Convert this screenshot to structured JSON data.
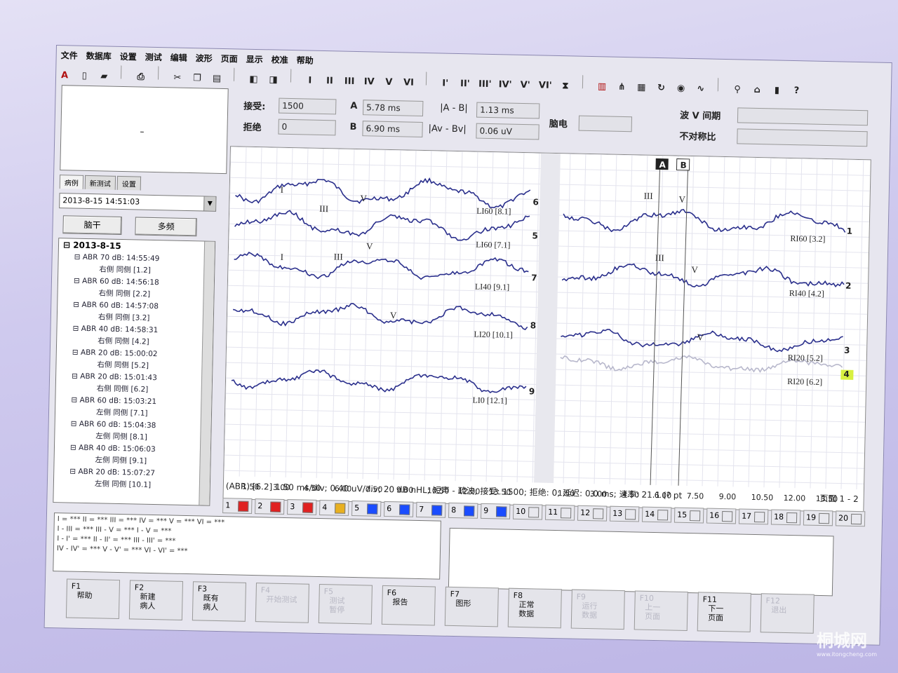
{
  "menu": [
    "文件",
    "数据库",
    "设置",
    "测试",
    "编辑",
    "波形",
    "页面",
    "显示",
    "校准",
    "帮助"
  ],
  "toolbar": {
    "roman": [
      "I",
      "II",
      "III",
      "IV",
      "V",
      "VI"
    ],
    "roman_prime": [
      "I'",
      "II'",
      "III'",
      "IV'",
      "V'",
      "VI'"
    ]
  },
  "info": {
    "accept_label": "接受:",
    "accept_value": "1500",
    "reject_label": "拒绝",
    "reject_value": "0",
    "a_label": "A",
    "a_value": "5.78 ms",
    "b_label": "B",
    "b_value": "6.90 ms",
    "ab_label": "|A - B|",
    "ab_value": "1.13 ms",
    "avbv_label": "|Av - Bv|",
    "avbv_value": "0.06 uV",
    "eeg_label": "脑电",
    "wave_v_label": "波 V 间期",
    "asym_label": "不对称比"
  },
  "left": {
    "tabs": [
      "病例",
      "新测试",
      "设置"
    ],
    "datetime": "2013-8-15 14:51:03",
    "btn_trunk": "脑干",
    "btn_multi": "多频",
    "tree_root": "2013-8-15",
    "tree": [
      {
        "node": "ABR 70 dB: 14:55:49",
        "child": "右侧 同侧 [1.2]"
      },
      {
        "node": "ABR 60 dB: 14:56:18",
        "child": "右侧 同侧 [2.2]"
      },
      {
        "node": "ABR 60 dB: 14:57:08",
        "child": "右侧 同侧 [3.2]"
      },
      {
        "node": "ABR 40 dB: 14:58:31",
        "child": "右侧 同侧 [4.2]"
      },
      {
        "node": "ABR 20 dB: 15:00:02",
        "child": "右侧 同侧 [5.2]"
      },
      {
        "node": "ABR 20 dB: 15:01:43",
        "child": "右侧 同侧 [6.2]"
      },
      {
        "node": "ABR 60 dB: 15:03:21",
        "child": "左侧 同侧 [7.1]"
      },
      {
        "node": "ABR 60 dB: 15:04:38",
        "child": "左侧 同侧 [8.1]"
      },
      {
        "node": "ABR 40 dB: 15:06:03",
        "child": "左侧 同侧 [9.1]"
      },
      {
        "node": "ABR 20 dB: 15:07:27",
        "child": "左侧 同侧 [10.1]"
      }
    ]
  },
  "plot": {
    "left_labels": [
      {
        "text": "LI60 [8.1]",
        "num": "6"
      },
      {
        "text": "LI60 [7.1]",
        "num": "5"
      },
      {
        "text": "LI40 [9.1]",
        "num": "7"
      },
      {
        "text": "LI20 [10.1]",
        "num": "8"
      },
      {
        "text": "LI0 [12.1]",
        "num": "9"
      }
    ],
    "right_labels": [
      {
        "text": "RI60 [3.2]",
        "num": "1"
      },
      {
        "text": "RI40 [4.2]",
        "num": "2"
      },
      {
        "text": "RI20 [5.2]",
        "num": "3"
      },
      {
        "text": "RI20 [6.2]",
        "num": "4"
      }
    ],
    "wave_marks": [
      "I",
      "III",
      "V",
      "I",
      "III",
      "V",
      "V",
      "III",
      "V",
      "III",
      "V",
      "V"
    ],
    "cursor_a": "A",
    "cursor_b": "B",
    "xticks": [
      "1.50",
      "3.00",
      "4.50",
      "6.00",
      "7.50",
      "9.00",
      "10.50",
      "12.00",
      "13.50"
    ],
    "trace_color": "#2a2f8c"
  },
  "status": {
    "text": "(ABR) [6.2]  1.50 ms/div;  0.40 uV/div;  20 dB nHL;  短声 - 疏波;  接受: 1500;  拒绝: 0;  延迟: 0.0 ms;  速率: 21.1 (? pt",
    "page": "页面 1 - 2"
  },
  "channels": [
    {
      "n": "1",
      "color": "#e02020"
    },
    {
      "n": "2",
      "color": "#e02020"
    },
    {
      "n": "3",
      "color": "#e02020"
    },
    {
      "n": "4",
      "color": "#e8b020"
    },
    {
      "n": "5",
      "color": "#1a4cff"
    },
    {
      "n": "6",
      "color": "#1a4cff"
    },
    {
      "n": "7",
      "color": "#1a4cff"
    },
    {
      "n": "8",
      "color": "#1a4cff"
    },
    {
      "n": "9",
      "color": "#1a4cff"
    },
    {
      "n": "10",
      "color": ""
    },
    {
      "n": "11",
      "color": ""
    },
    {
      "n": "12",
      "color": ""
    },
    {
      "n": "13",
      "color": ""
    },
    {
      "n": "14",
      "color": ""
    },
    {
      "n": "15",
      "color": ""
    },
    {
      "n": "16",
      "color": ""
    },
    {
      "n": "17",
      "color": ""
    },
    {
      "n": "18",
      "color": ""
    },
    {
      "n": "19",
      "color": ""
    },
    {
      "n": "20",
      "color": ""
    }
  ],
  "peaks": {
    "line1": "I = ***    II = ***    III = ***    IV = ***    V = ***    VI = ***",
    "line2": "I - III = ***    III - V = ***    I - V = ***",
    "line3": "I - I' = ***    II - II' = ***    III - III' = ***",
    "line4": "IV - IV' = ***    V - V' = ***    VI - VI' = ***"
  },
  "fkeys": [
    {
      "key": "F1",
      "label": "帮助",
      "enabled": true
    },
    {
      "key": "F2",
      "label": "新建\n病人",
      "enabled": true
    },
    {
      "key": "F3",
      "label": "既有\n病人",
      "enabled": true
    },
    {
      "key": "F4",
      "label": "开始测试",
      "enabled": false
    },
    {
      "key": "F5",
      "label": "测试\n暂停",
      "enabled": false
    },
    {
      "key": "F6",
      "label": "报告",
      "enabled": true
    },
    {
      "key": "F7",
      "label": "图形",
      "enabled": true
    },
    {
      "key": "F8",
      "label": "正常\n数据",
      "enabled": true
    },
    {
      "key": "F9",
      "label": "运行\n数据",
      "enabled": false
    },
    {
      "key": "F10",
      "label": "上一\n页面",
      "enabled": false
    },
    {
      "key": "F11",
      "label": "下一\n页面",
      "enabled": true
    },
    {
      "key": "F12",
      "label": "退出",
      "enabled": false
    }
  ],
  "watermark": {
    "text": "桐城网",
    "url": "www.itongcheng.com"
  }
}
